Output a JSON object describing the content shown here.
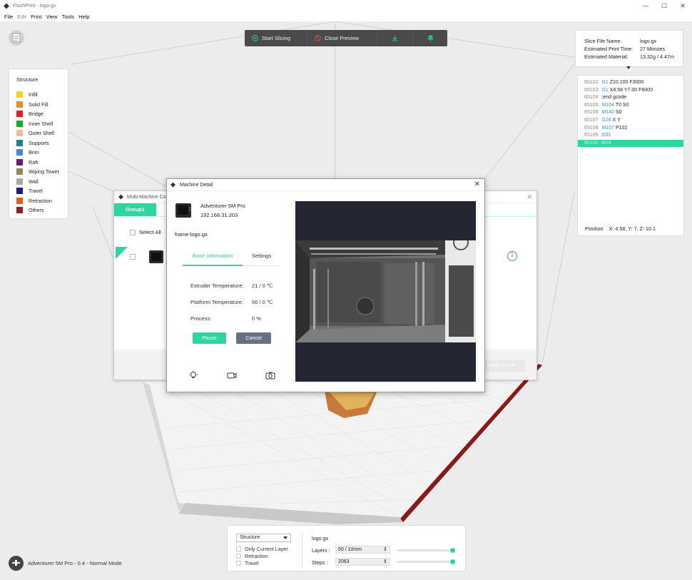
{
  "window": {
    "title": "FlashPrint - logo.gx",
    "controls": [
      "—",
      "☐",
      "✕"
    ]
  },
  "menu": [
    "File",
    "Edit",
    "Print",
    "View",
    "Tools",
    "Help"
  ],
  "toolbar": {
    "start_slicing": "Start Slicing",
    "close_preview": "Close Preview"
  },
  "legend": {
    "title": "Structure",
    "items": [
      {
        "label": "Infill",
        "color": "#f7d21a"
      },
      {
        "label": "Solid Fill",
        "color": "#ef8a1e"
      },
      {
        "label": "Bridge",
        "color": "#e21e1e"
      },
      {
        "label": "Inner Shell",
        "color": "#18a827"
      },
      {
        "label": "Outer Shell",
        "color": "#f3b998"
      },
      {
        "label": "Supports",
        "color": "#1c7f8d"
      },
      {
        "label": "Brim",
        "color": "#4a7ff0"
      },
      {
        "label": "Raft",
        "color": "#6a1a73"
      },
      {
        "label": "Wiping Tower",
        "color": "#8f8a4a"
      },
      {
        "label": "Wall",
        "color": "#a8a8a8"
      },
      {
        "label": "Travel",
        "color": "#1a1a8a"
      },
      {
        "label": "Retraction",
        "color": "#e85a15"
      },
      {
        "label": "Others",
        "color": "#8a2020"
      }
    ]
  },
  "slice_info": {
    "file_label": "Slice File Name:",
    "file_value": "logo.gx",
    "time_label": "Estimated Print Time:",
    "time_value": "27 Minutes",
    "material_label": "Estimated Material:",
    "material_value": "13.32g / 4.47m"
  },
  "gcode": {
    "lines": [
      {
        "num": "65102",
        "cmd": "G1",
        "args": "Z10.100 F3000"
      },
      {
        "num": "65103",
        "cmd": "G1",
        "args": "X4.58 Y7.00 F6000"
      },
      {
        "num": "65104",
        "cmd": "",
        "args": ";end gcode"
      },
      {
        "num": "65105",
        "cmd": "M104",
        "args": "T0 S0"
      },
      {
        "num": "65106",
        "cmd": "M140",
        "args": "S0"
      },
      {
        "num": "65107",
        "cmd": "G28",
        "args": "X Y"
      },
      {
        "num": "65108",
        "cmd": "M107",
        "args": "P102"
      },
      {
        "num": "65109",
        "cmd": "G91",
        "args": ""
      },
      {
        "num": "65110",
        "cmd": "M18",
        "args": ""
      }
    ],
    "position_label": "Position",
    "position_value": "X: 4.58, Y: 7, Z: 10.1"
  },
  "multi_machine": {
    "title": "Multi-Machine Control",
    "tab": "Group1",
    "select_all": "Select All",
    "send_button": "Send GCode"
  },
  "machine_detail": {
    "title": "Machine Detail",
    "printer_name": "Adventurer 5M Pro",
    "ip": "192.168.31.203",
    "file": "frame-logo.gx",
    "tab_active": "Base Information",
    "tab_inactive": "Settings",
    "extruder_label": "Extruder Temperature:",
    "extruder_value": "21 / 0 ℃",
    "platform_label": "Platform Temperature:",
    "platform_value": "56 / 0 ℃",
    "process_label": "Process:",
    "process_value": "0 %",
    "pause": "Pause",
    "cancel": "Cancel"
  },
  "preview": {
    "structure_select": "Structure",
    "only_current_layer": "Only Current Layer",
    "retraction": "Retraction",
    "travel": "Travel",
    "file": "logo.gx",
    "layers_label": "Layers :",
    "layers_value": "50 / 10mm",
    "steps_label": "Steps :",
    "steps_value": "2063"
  },
  "status": {
    "machine": "Adventurer 5M Pro - 0.4 - Normal Mode"
  },
  "accent_color": "#2bd6a1"
}
